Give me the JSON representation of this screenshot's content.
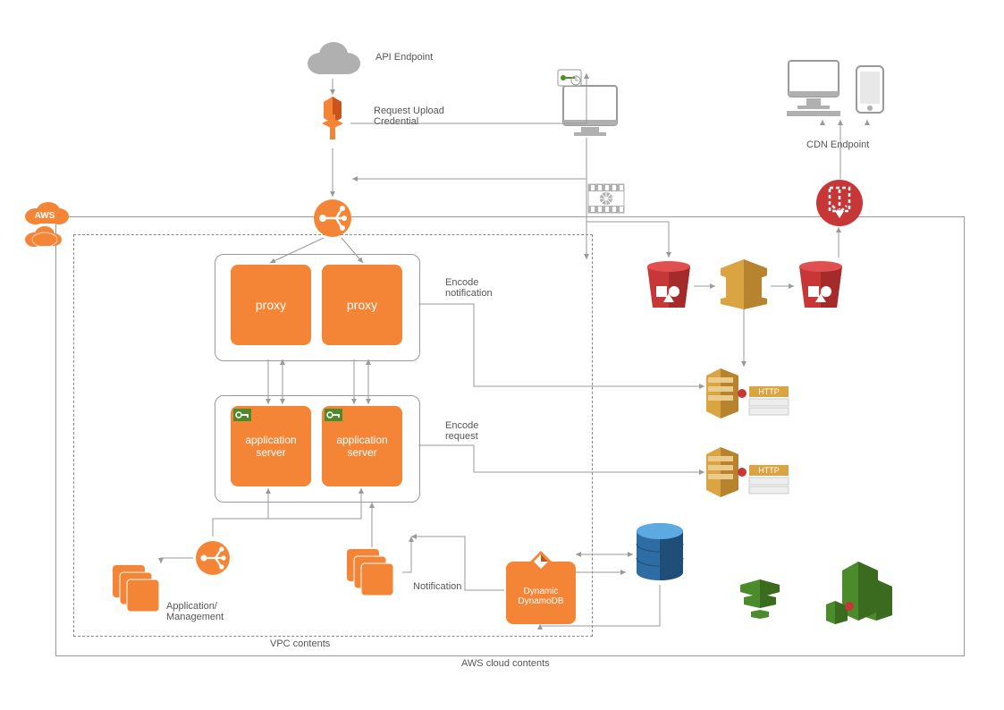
{
  "labels": {
    "api_endpoint": "API Endpoint",
    "request_upload": "Request Upload\nCredential",
    "cdn_endpoint": "CDN Endpoint",
    "encode_notification": "Encode\nnotification",
    "encode_request": "Encode\nrequest",
    "notification": "Notification",
    "application_mgmt": "Application/\nManagement",
    "vpc_contents": "VPC contents",
    "aws_cloud_contents": "AWS cloud contents",
    "http": "HTTP"
  },
  "nodes": {
    "proxy": "proxy",
    "app_server": "application\nserver",
    "dynamodb": "Dynamic\nDynamoDB"
  },
  "badges": {
    "aws": "AWS"
  },
  "colors": {
    "orange": "#F58536",
    "dark_orange": "#C8511B",
    "red": "#C83737",
    "dark_red": "#A52A2A",
    "yellow": "#D9A441",
    "dark_yellow": "#B7832F",
    "blue": "#2E6DA4",
    "dark_blue": "#1F4E79",
    "green": "#4C8B2B",
    "dark_green": "#3A6B1F",
    "gray": "#B0B0B0",
    "dark_gray": "#808080"
  }
}
